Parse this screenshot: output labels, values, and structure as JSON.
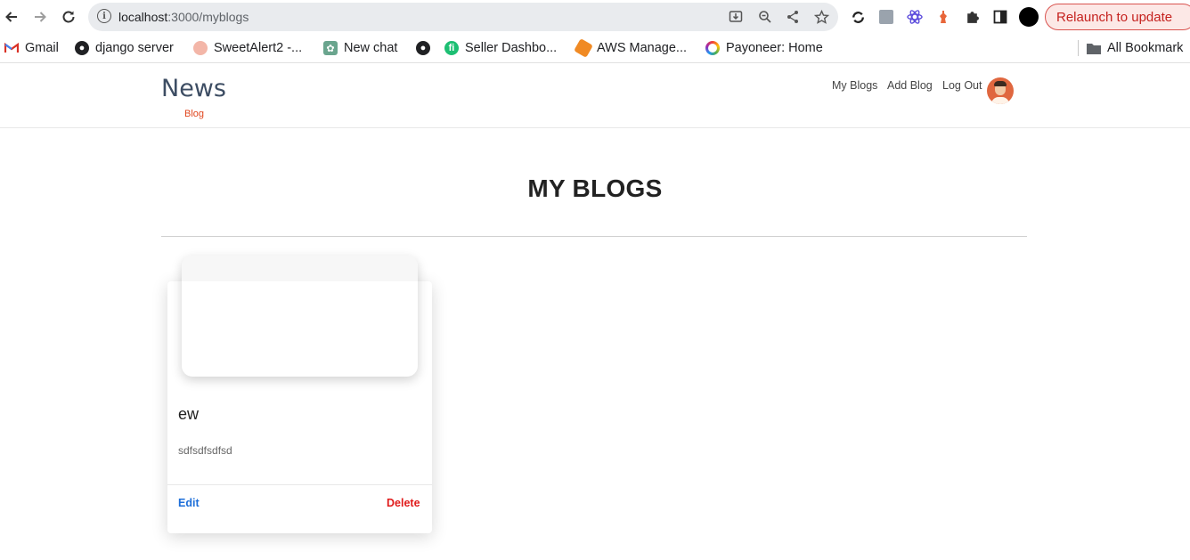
{
  "browser": {
    "url_host": "localhost",
    "url_path": ":3000/myblogs",
    "relaunch_label": "Relaunch to update"
  },
  "bookmarks": [
    {
      "label": "Gmail",
      "icon": "gmail-icon"
    },
    {
      "label": "django server",
      "icon": "globe-icon"
    },
    {
      "label": "SweetAlert2 -...",
      "icon": "sweetalert-icon"
    },
    {
      "label": "New chat",
      "icon": "chatgpt-icon"
    },
    {
      "label": "",
      "icon": "globe-icon"
    },
    {
      "label": "Seller Dashbo...",
      "icon": "fiverr-icon"
    },
    {
      "label": "AWS Manage...",
      "icon": "aws-icon"
    },
    {
      "label": "Payoneer: Home",
      "icon": "payoneer-icon"
    },
    {
      "label": "All Bookmark",
      "icon": "folder-icon"
    }
  ],
  "site": {
    "brand_title": "News",
    "brand_subtitle": "Blog",
    "nav": [
      "My Blogs",
      "Add Blog",
      "Log Out"
    ]
  },
  "main": {
    "title": "MY BLOGS",
    "posts": [
      {
        "title": "ew",
        "description": "sdfsdfsdfsd",
        "edit_label": "Edit",
        "delete_label": "Delete"
      }
    ]
  },
  "colors": {
    "brand": "#3d4d63",
    "brand_accent": "#e0461e",
    "edit": "#1e6fd9",
    "delete": "#e01b1b",
    "relaunch": "#c5221f"
  }
}
